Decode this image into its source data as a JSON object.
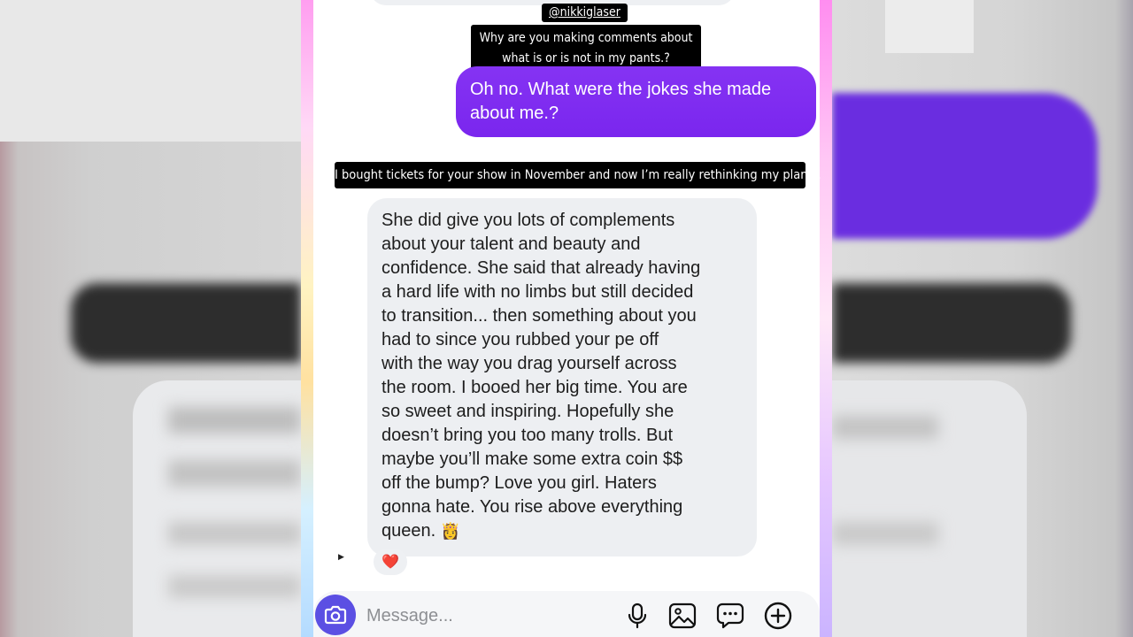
{
  "story": {
    "username_tag": "@nikkiglaser",
    "question_line1": "Why are you making comments about",
    "question_line2": "what is or is not in my pants.?",
    "caption": "I bought tickets for your show in November and now I’m really rethinking my plans.."
  },
  "conversation": {
    "sent_message": "Oh no. What were the jokes she made about me.?",
    "received_message": "She did give you lots of complements\nabout your talent and beauty and\nconfidence.  She said that already having\na hard life with no limbs but still decided\nto transition... then something about you\nhad to since you rubbed your pe      off\nwith the way you drag yourself across\nthe room. I booed her big time. You are\nso sweet and inspiring. Hopefully she\ndoesn’t bring you too many trolls. But\nmaybe you’ll make some extra coin $$\noff the bump? Love you girl. Haters\ngonna hate. You rise above everything\nqueen.",
    "received_emoji": "👸",
    "reaction": "❤️"
  },
  "composer": {
    "placeholder": "Message...",
    "icons": [
      "camera-icon",
      "microphone-icon",
      "image-icon",
      "chat-bubble-icon",
      "plus-circle-icon"
    ],
    "camera_color": "#5b4fe3"
  },
  "colors": {
    "sent_bubble": "#7d2cf0",
    "received_bubble": "#edeff2"
  }
}
